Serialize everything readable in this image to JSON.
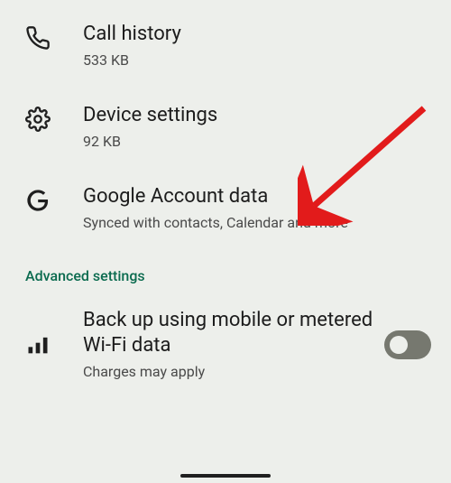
{
  "items": [
    {
      "title": "Call history",
      "subtitle": "533 KB"
    },
    {
      "title": "Device settings",
      "subtitle": "92 KB"
    },
    {
      "title": "Google Account data",
      "subtitle": "Synced with contacts, Calendar and more"
    }
  ],
  "section_header": "Advanced settings",
  "toggle": {
    "title": "Back up using mobile or metered Wi-Fi data",
    "subtitle": "Charges may apply",
    "value": false
  }
}
